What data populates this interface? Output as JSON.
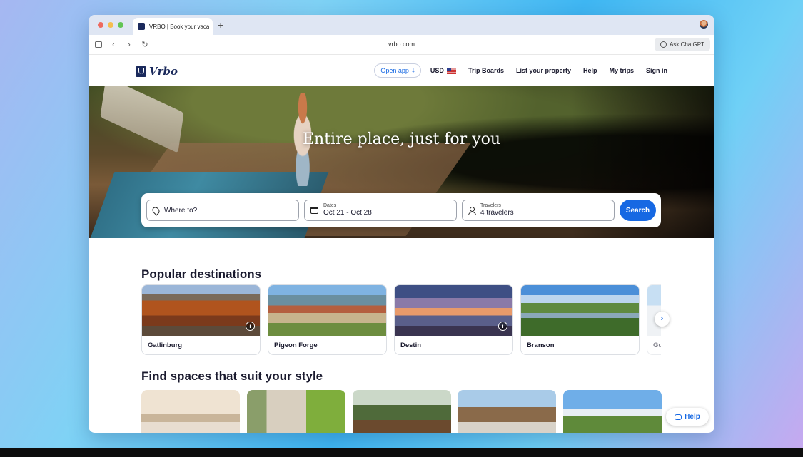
{
  "browser": {
    "tab_title": "VRBO | Book your vaca",
    "new_tab_symbol": "+",
    "url": "vrbo.com",
    "ask_chatgpt": "Ask ChatGPT"
  },
  "header": {
    "logo_text": "Vrbo",
    "open_app": "Open app",
    "currency": "USD",
    "nav": [
      "Trip Boards",
      "List your property",
      "Help",
      "My trips",
      "Sign in"
    ]
  },
  "hero": {
    "headline": "Entire place, just for you"
  },
  "search": {
    "where_placeholder": "Where to?",
    "dates_label": "Dates",
    "dates_value": "Oct 21 - Oct 28",
    "travelers_label": "Travelers",
    "travelers_value": "4 travelers",
    "button": "Search"
  },
  "popular": {
    "title": "Popular destinations",
    "destinations": [
      "Gatlinburg",
      "Pigeon Forge",
      "Destin",
      "Branson",
      "Gu"
    ]
  },
  "styles": {
    "title": "Find spaces that suit your style"
  },
  "help_fab": "Help",
  "colors": {
    "brand_navy": "#1b2a5c",
    "accent_blue": "#1668e3"
  }
}
